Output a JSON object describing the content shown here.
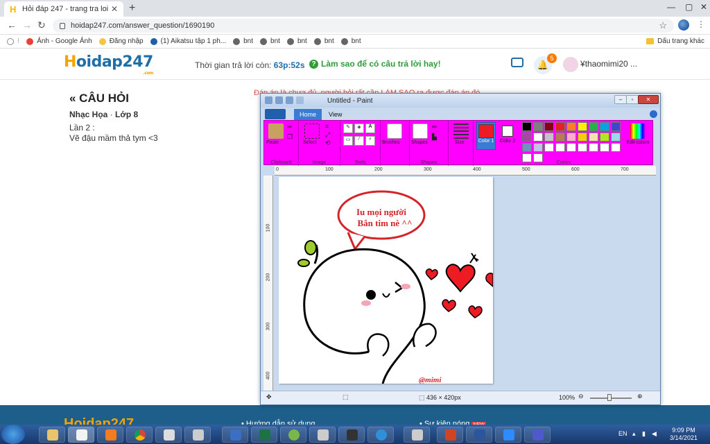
{
  "browser": {
    "tab_title": "Hỏi đáp 247 - trang tra loi",
    "url": "hoidap247.com/answer_question/1690190",
    "bookmarks": [
      "Ảnh - Google Ảnh",
      "Đăng nhập",
      "(1) Aikatsu tập 1 ph...",
      "bnt",
      "bnt",
      "bnt",
      "bnt",
      "bnt"
    ],
    "bookmark_folder": "Dấu trang khác"
  },
  "site": {
    "logo_h": "H",
    "logo_rest": "oidap247",
    "logo_com": ".com",
    "timer_label": "Thời gian trả lời còn:",
    "timer_value": "63p:52s",
    "howto": "Làm sao để có câu trả lời hay!",
    "notification_count": "5",
    "username": "thaomimi20 ..."
  },
  "question": {
    "heading": "« CÂU HỎI",
    "subject": "Nhạc Họa",
    "separator": " · ",
    "grade": "Lớp 8",
    "line1": "Lần 2 :",
    "line2": "Vẽ đậu mầm thả tym <3",
    "warning": "Đáp án là chưa đủ, người hỏi rất cần LÀM SAO ra được đáp án đó"
  },
  "paint": {
    "title": "Untitled - Paint",
    "tabs": [
      "Home",
      "View"
    ],
    "groups": [
      "Clipboard",
      "Image",
      "Tools",
      "Brushes",
      "Shapes",
      "Size",
      "Colors"
    ],
    "buttons": {
      "paste": "Paste",
      "select": "Select",
      "brushes": "Brushes",
      "shapes": "Shapes",
      "size": "Size",
      "color1": "Color 1",
      "color2": "Color 2",
      "edit_colors": "Edit colors"
    },
    "ruler_h": [
      "0",
      "100",
      "200",
      "300",
      "400",
      "500",
      "600",
      "700"
    ],
    "ruler_v": [
      "100",
      "200",
      "300",
      "400"
    ],
    "canvas_size": "436 × 420px",
    "zoom": "100%",
    "palette": [
      "#000000",
      "#7f7f7f",
      "#880015",
      "#ed1c24",
      "#ff7f27",
      "#fff200",
      "#22b14c",
      "#00a2e8",
      "#3f48cc",
      "#a349a4",
      "#ffffff",
      "#c3c3c3",
      "#b97a57",
      "#ffaec9",
      "#ffc90e",
      "#efe4b0",
      "#b5e61d",
      "#99d9ea",
      "#7092be",
      "#c8bfe7",
      "#ffffff",
      "#ffffff",
      "#ffffff",
      "#ffffff",
      "#ffffff",
      "#ffffff",
      "#ffffff",
      "#ffffff",
      "#ffffff"
    ],
    "color1": "#ed1c24",
    "color2": "#ffffff",
    "drawing": {
      "speech_line1": "Iu mọi người",
      "speech_line2": "Bắn tim nè ^^",
      "signature": "@mimi"
    }
  },
  "footer": {
    "logo": "Hoidap247",
    "link1": "Hướng dẫn sử dụng",
    "link2": "Sự kiện nóng"
  },
  "taskbar": {
    "lang": "EN",
    "time": "9:09 PM",
    "date": "3/14/2021"
  }
}
